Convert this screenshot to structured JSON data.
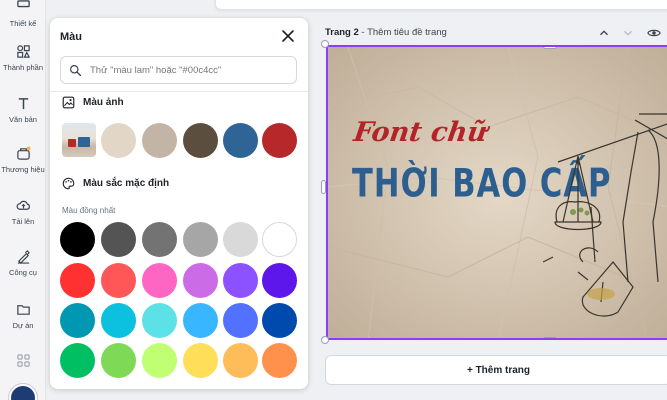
{
  "sidebar": {
    "items": [
      {
        "label": "Thiết kế",
        "icon": "layout-icon"
      },
      {
        "label": "Thành phần",
        "icon": "shapes-icon"
      },
      {
        "label": "Văn bản",
        "icon": "text-icon"
      },
      {
        "label": "Thương hiệu",
        "icon": "brand-icon"
      },
      {
        "label": "Tải lên",
        "icon": "cloud-upload-icon"
      },
      {
        "label": "Công cụ",
        "icon": "pen-tool-icon"
      },
      {
        "label": "Dự án",
        "icon": "folder-icon"
      },
      {
        "label": "",
        "icon": "apps-icon"
      }
    ]
  },
  "panel": {
    "title": "Màu",
    "search_placeholder": "Thử \"màu lam\" hoặc \"#00c4cc\"",
    "photo_section_title": "Màu ảnh",
    "photo_colors": [
      "#e2d6c6",
      "#c3b5a5",
      "#5c4e3e",
      "#2f6496",
      "#b7282b"
    ],
    "default_section_title": "Màu sắc mặc định",
    "solid_label": "Màu đồng nhất",
    "default_colors": [
      [
        "#000000",
        "#545454",
        "#737373",
        "#a6a6a6",
        "#d9d9d9",
        "#ffffff"
      ],
      [
        "#ff3131",
        "#ff5757",
        "#ff66c4",
        "#cb6ce6",
        "#8c52ff",
        "#5e17eb"
      ],
      [
        "#0097b2",
        "#0cc0df",
        "#5ce1e6",
        "#38b6ff",
        "#5271ff",
        "#004aad"
      ],
      [
        "#00bf63",
        "#7ed957",
        "#c1ff72",
        "#ffde59",
        "#ffbd59",
        "#ff914d"
      ]
    ]
  },
  "canvas": {
    "page_label_strong": "Trang 2",
    "page_label_rest": " - Thêm tiêu đề trang",
    "script_text": "Font chữ",
    "main_text": "THỜI BAO CẤP",
    "background_color": "#d9cbb8",
    "accent_color": "#8b3dff"
  },
  "add_page_label": "+ Thêm trang"
}
